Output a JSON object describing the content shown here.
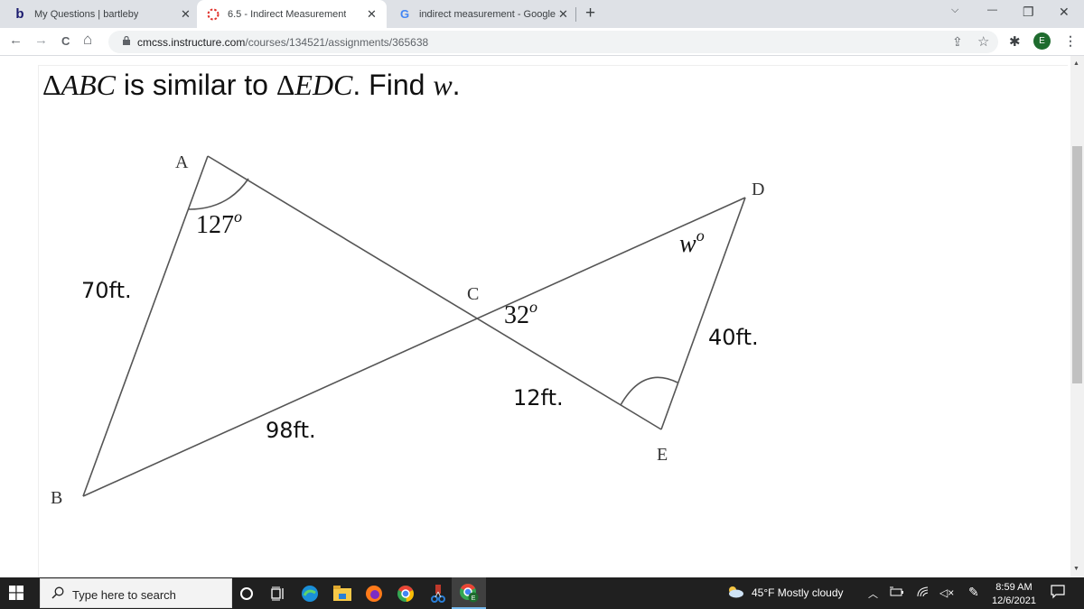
{
  "browser": {
    "tabs": [
      {
        "favicon": "bartleby-b-icon",
        "title": "My Questions | bartleby",
        "active": false
      },
      {
        "favicon": "canvas-loading-icon",
        "title": "6.5 - Indirect Measurement",
        "active": true
      },
      {
        "favicon": "google-g-icon",
        "title": "indirect measurement - Google S",
        "active": false
      }
    ],
    "favicon_glyphs": {
      "bartleby": "b",
      "google": "G"
    },
    "new_tab_label": "+",
    "close_glyph": "✕",
    "url_host": "cmcss.instructure.com",
    "url_path": "/courses/134521/assignments/365638",
    "profile_initial": "E",
    "window_controls": {
      "tab_search": "⌵",
      "minimize": "—",
      "restore": "❐",
      "close": "✕"
    },
    "nav": {
      "back": "←",
      "forward": "→",
      "reload": "C",
      "home": "⌂"
    },
    "icons": {
      "share": "⇪",
      "bookmark": "☆",
      "extensions": "✱",
      "menu": "⋮",
      "lock": "🔒"
    }
  },
  "question": {
    "triangle_symbol": "Δ",
    "tri1": "ABC",
    "text1": " is similar to ",
    "tri2": "EDC",
    "text2": ". Find ",
    "variable": "w",
    "end": "."
  },
  "diagram": {
    "vertices": {
      "A": "A",
      "B": "B",
      "C": "C",
      "D": "D",
      "E": "E"
    },
    "angle_A": "127",
    "angle_C": "32",
    "angle_D": "w",
    "degree": "o",
    "side_AB": "70ft.",
    "side_BC": "98ft.",
    "side_CE": "12ft.",
    "side_DE": "40ft."
  },
  "taskbar": {
    "search_placeholder": "Type here to search",
    "weather": "45°F  Mostly cloudy",
    "time": "8:59 AM",
    "date": "12/6/2021",
    "apps": [
      "cortana",
      "task-view",
      "edge",
      "file-explorer",
      "firefox",
      "chrome",
      "snipping-tool",
      "chrome-profile-e"
    ]
  },
  "colors": {
    "accent_profile": "#1e6b2e",
    "canvas_red": "#e0312b",
    "taskbar_bg": "#202020"
  }
}
